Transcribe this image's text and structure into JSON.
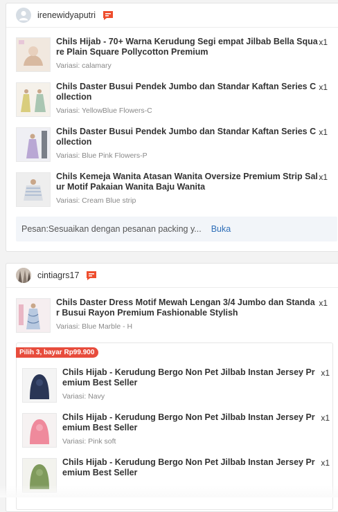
{
  "orders": [
    {
      "buyer": "irenewidyaputri",
      "items": [
        {
          "title": "Chils Hijab - 70+ Warna Kerudung Segi empat Jilbab Bella Square Plain Square Pollycotton Premium",
          "variant": "Variasi: calamary",
          "qty": "x1"
        },
        {
          "title": "Chils Daster Busui Pendek Jumbo dan Standar Kaftan Series Collection",
          "variant": "Variasi: YellowBlue Flowers-C",
          "qty": "x1"
        },
        {
          "title": "Chils Daster Busui Pendek Jumbo dan Standar Kaftan Series Collection",
          "variant": "Variasi: Blue Pink Flowers-P",
          "qty": "x1"
        },
        {
          "title": "Chils Kemeja Wanita Atasan Wanita Oversize Premium Strip Salur Motif Pakaian Wanita Baju Wanita",
          "variant": "Variasi: Cream Blue strip",
          "qty": "x1"
        }
      ],
      "note": "Pesan:Sesuaikan dengan pesanan packing y...",
      "note_link": "Buka"
    },
    {
      "buyer": "cintiagrs17",
      "items": [
        {
          "title": "Chils Daster Dress Motif Mewah Lengan 3/4 Jumbo dan Standar Busui Rayon Premium Fashionable Stylish",
          "variant": "Variasi: Blue Marble - H",
          "qty": "x1"
        }
      ],
      "bundle": {
        "badge": "Pilih 3, bayar Rp99.900",
        "items": [
          {
            "title": "Chils Hijab - Kerudung Bergo Non Pet Jilbab Instan Jersey Premium Best Seller",
            "variant": "Variasi: Navy",
            "qty": "x1"
          },
          {
            "title": "Chils Hijab - Kerudung Bergo Non Pet Jilbab Instan Jersey Premium Best Seller",
            "variant": "Variasi: Pink soft",
            "qty": "x1"
          },
          {
            "title": "Chils Hijab - Kerudung Bergo Non Pet Jilbab Instan Jersey Premium Best Seller",
            "variant": "",
            "qty": "x1"
          }
        ]
      }
    }
  ],
  "colors": {
    "accent_red": "#ee4d2d",
    "link_blue": "#2f6fb8",
    "promo_red": "#e74c3c"
  },
  "icons": {
    "chat": "chat-bubble-icon",
    "avatar_default": "user-icon"
  }
}
